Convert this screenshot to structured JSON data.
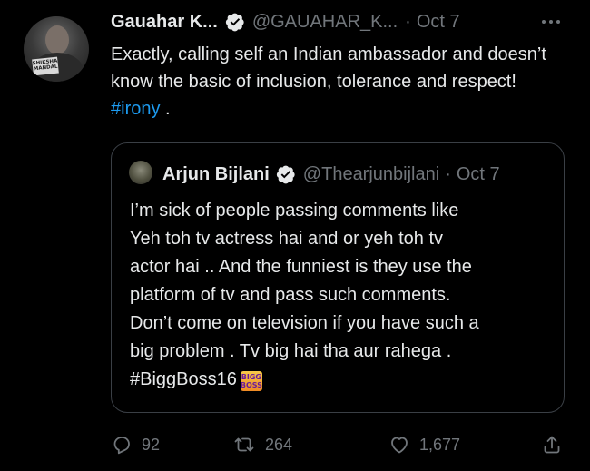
{
  "tweet": {
    "author": {
      "display_name": "Gauahar K...",
      "handle": "@GAUAHAR_K...",
      "separator": "·",
      "date": "Oct 7",
      "avatar_sticker_text": "SHIKSHA MANDAL"
    },
    "text_before_hashtag": "Exactly, calling self an Indian ambassador and doesn’t know the basic of inclusion, tolerance and respect! ",
    "hashtag": "#irony",
    "text_after_hashtag": " .",
    "more_icon": "more-horizontal-icon"
  },
  "quoted_tweet": {
    "display_name": "Arjun Bijlani",
    "handle": "@Thearjunbijlani",
    "separator": "·",
    "date": "Oct 7",
    "lines": [
      "I’m sick of people passing comments like",
      "Yeh toh tv actress hai and or yeh toh tv",
      "actor hai .. And the funniest is they use the",
      "platform of tv and pass such comments.",
      "Don’t come on television if you have such a",
      "big problem . Tv big hai tha aur rahega ."
    ],
    "hashtag": "#BiggBoss16",
    "hashtag_logo_text": "BIGG BOSS"
  },
  "actions": {
    "reply_count": "92",
    "retweet_count": "264",
    "like_count": "1,677"
  },
  "colors": {
    "background": "#000000",
    "text_primary": "#e7e9ea",
    "text_secondary": "#71767b",
    "link": "#1d9bf0",
    "border": "#3a3f45"
  }
}
